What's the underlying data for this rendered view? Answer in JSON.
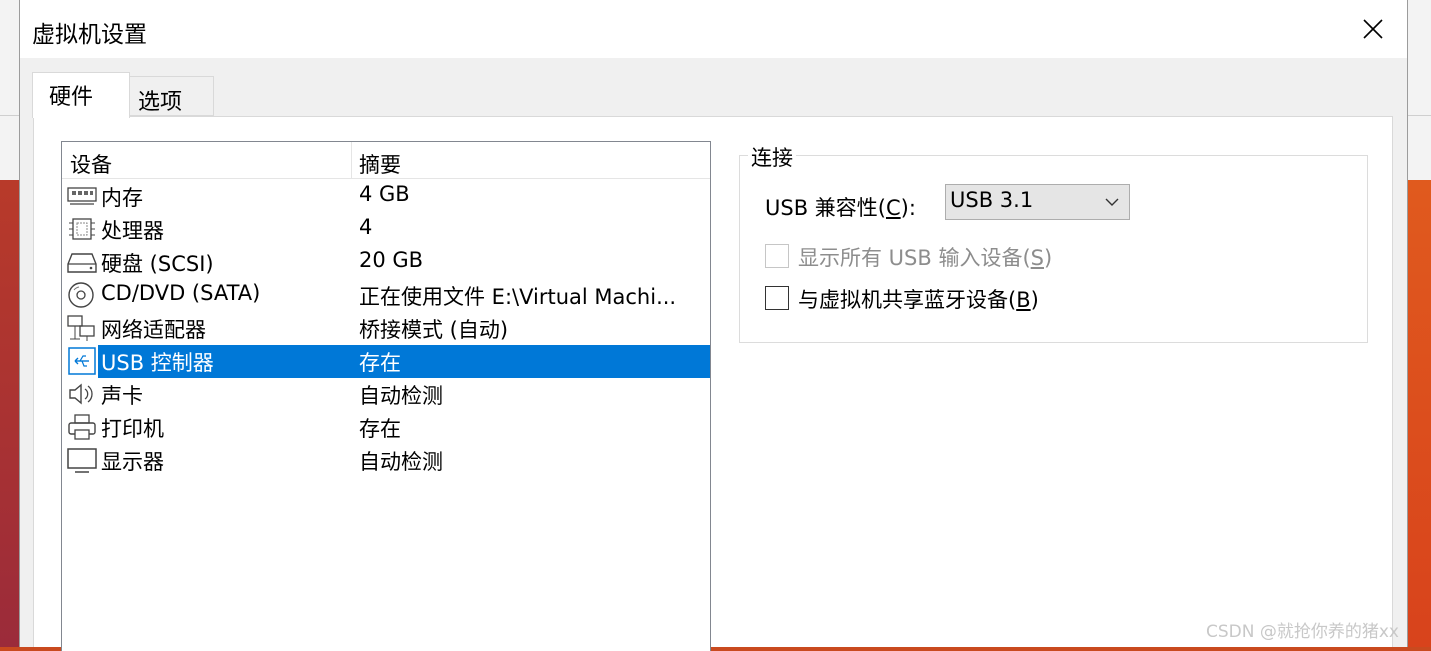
{
  "window": {
    "title": "虚拟机设置"
  },
  "tabs": [
    {
      "label": "硬件"
    },
    {
      "label": "选项"
    }
  ],
  "device_list": {
    "columns": {
      "device": "设备",
      "summary": "摘要"
    },
    "rows": [
      {
        "name": "内存",
        "summary": "4 GB",
        "icon": "memory-icon",
        "selected": false
      },
      {
        "name": "处理器",
        "summary": "4",
        "icon": "processor-icon",
        "selected": false
      },
      {
        "name": "硬盘 (SCSI)",
        "summary": "20 GB",
        "icon": "hard-disk-icon",
        "selected": false
      },
      {
        "name": "CD/DVD (SATA)",
        "summary": "正在使用文件 E:\\Virtual Machi...",
        "icon": "cd-dvd-icon",
        "selected": false
      },
      {
        "name": "网络适配器",
        "summary": "桥接模式 (自动)",
        "icon": "network-adapter-icon",
        "selected": false
      },
      {
        "name": "USB 控制器",
        "summary": "存在",
        "icon": "usb-icon",
        "selected": true
      },
      {
        "name": "声卡",
        "summary": "自动检测",
        "icon": "speaker-icon",
        "selected": false
      },
      {
        "name": "打印机",
        "summary": "存在",
        "icon": "printer-icon",
        "selected": false
      },
      {
        "name": "显示器",
        "summary": "自动检测",
        "icon": "monitor-icon",
        "selected": false
      }
    ]
  },
  "connection": {
    "group_label": "连接",
    "compat_label": "USB 兼容性(",
    "compat_key": "C",
    "compat_tail": "):",
    "compat_value": "USB 3.1",
    "show_all_label": "显示所有 USB 输入设备(",
    "show_all_key": "S",
    "show_all_tail": ")",
    "show_all_checked": false,
    "show_all_enabled": false,
    "share_bt_label": "与虚拟机共享蓝牙设备(",
    "share_bt_key": "B",
    "share_bt_tail": ")",
    "share_bt_checked": false
  },
  "watermark": "CSDN @就抢你养的猪xx",
  "colors": {
    "selection": "#0078d7",
    "window_bg": "#f0f0f0"
  }
}
